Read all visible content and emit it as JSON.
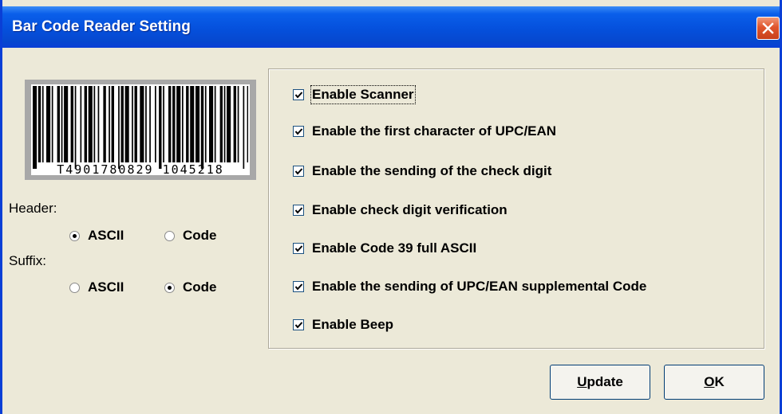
{
  "window": {
    "title": "Bar Code Reader Setting"
  },
  "barcode": {
    "number": "T4901780829 1045218"
  },
  "header": {
    "label": "Header:",
    "options": [
      {
        "label": "ASCII",
        "selected": true
      },
      {
        "label": "Code",
        "selected": false
      }
    ]
  },
  "suffix": {
    "label": "Suffix:",
    "options": [
      {
        "label": "ASCII",
        "selected": false
      },
      {
        "label": "Code",
        "selected": true
      }
    ]
  },
  "options": [
    {
      "label": "Enable Scanner",
      "checked": true
    },
    {
      "label": "Enable the first character of UPC/EAN",
      "checked": true
    },
    {
      "label": "Enable the sending of the check digit",
      "checked": true
    },
    {
      "label": "Enable check digit verification",
      "checked": true
    },
    {
      "label": "Enable Code 39 full ASCII",
      "checked": true
    },
    {
      "label": "Enable the sending of UPC/EAN supplemental Code",
      "checked": true
    },
    {
      "label": "Enable Beep",
      "checked": true
    }
  ],
  "buttons": {
    "update": {
      "mnemonic": "U",
      "rest": "pdate"
    },
    "ok": {
      "mnemonic": "O",
      "rest": "K"
    }
  }
}
